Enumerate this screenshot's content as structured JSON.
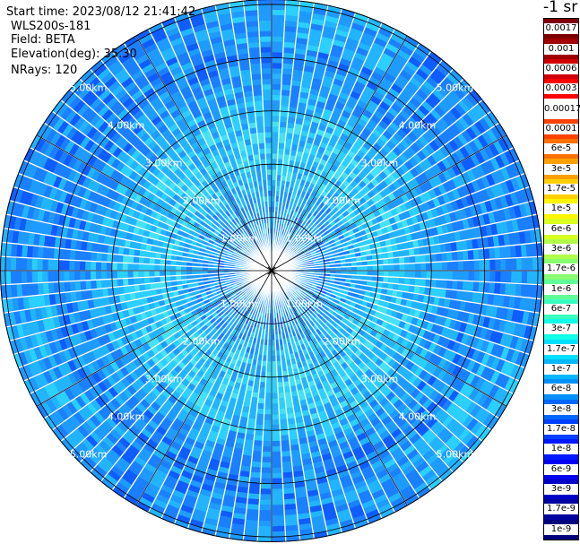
{
  "info": {
    "start_time": "Start time: 2023/08/12 21:41:42",
    "lidar": "WLS200s-181",
    "field": "Field: BETA",
    "elevation": "Elevation(deg): 35.30",
    "nrays": "NRays: 120"
  },
  "colorbar": {
    "unit_title": "-1 sr",
    "labels": [
      "0.0017",
      "0.001",
      "0.0006",
      "0.0003",
      "0.00017",
      "0.0001",
      "6e-5",
      "3e-5",
      "1.7e-5",
      "1e-5",
      "6e-6",
      "3e-6",
      "1.7e-6",
      "1e-6",
      "6e-7",
      "3e-7",
      "1.7e-7",
      "1e-7",
      "6e-8",
      "3e-8",
      "1.7e-8",
      "1e-8",
      "6e-9",
      "3e-9",
      "1.7e-9",
      "1e-9"
    ],
    "colors": [
      "#800000",
      "#a00000",
      "#d00000",
      "#ff0000",
      "#ffffff",
      "#ff4000",
      "#ff7000",
      "#ffa000",
      "#ffcf00",
      "#fff500",
      "#d8ff20",
      "#b0ff48",
      "#88ff70",
      "#60ff98",
      "#38ffc0",
      "#10ffe8",
      "#00e0ff",
      "#00b8ff",
      "#0090ff",
      "#0068ff",
      "#0040ff",
      "#0018ff",
      "#0000f0",
      "#0000c8",
      "#0000a0",
      "#000080"
    ]
  },
  "chart_data": {
    "type": "heatmap",
    "projection": "polar-ppi",
    "field": "BETA",
    "units": "sr-1",
    "n_rays": 120,
    "elevation_deg": 35.3,
    "range_rings_km": [
      1.0,
      2.0,
      3.0,
      4.0,
      5.0
    ],
    "ring_labels": [
      "1.00km",
      "2.00km",
      "3.00km",
      "4.00km",
      "5.00km"
    ],
    "spoke_angles_deg": [
      0,
      30,
      60,
      90,
      120,
      150,
      180,
      210,
      240,
      270,
      300,
      330
    ],
    "max_range_km": 5.1,
    "dominant_value_range": [
      "1e-8",
      "1.7e-7"
    ],
    "notes": "Backscatter mostly 3e-8 to 1e-7 (blue to cyan); slightly higher (1e-7 to 1.7e-7, light cyan) in an annulus at roughly 1.5-3.5 km range."
  }
}
